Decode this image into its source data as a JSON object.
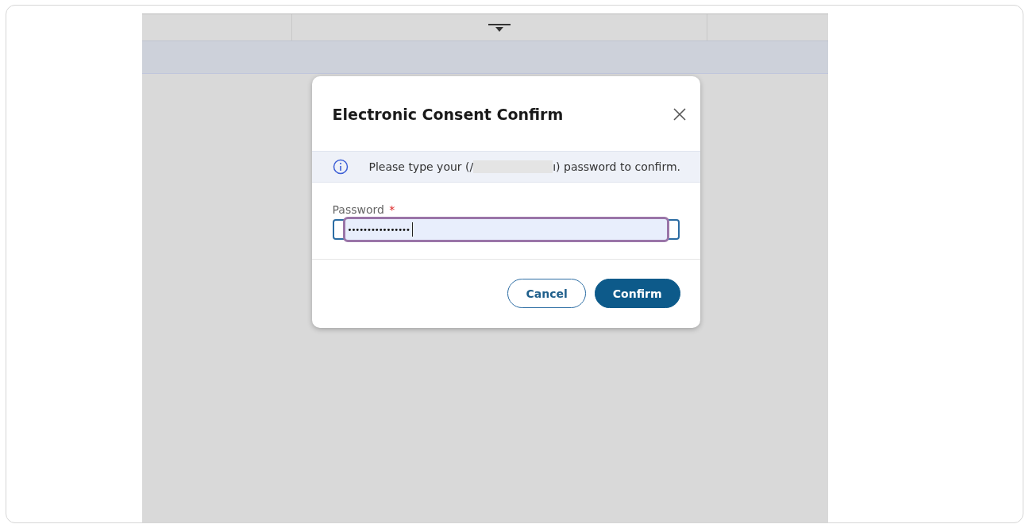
{
  "dialog": {
    "title": "Electronic Consent Confirm",
    "info": {
      "before": "Please type your (/",
      "after": "ı) password to confirm."
    },
    "field": {
      "label": "Password",
      "required_mark": "*",
      "value": "••••••••••••••••",
      "focused": true
    },
    "buttons": [
      {
        "label": "Cancel",
        "kind": "secondary"
      },
      {
        "label": "Confirm",
        "kind": "primary"
      }
    ]
  }
}
